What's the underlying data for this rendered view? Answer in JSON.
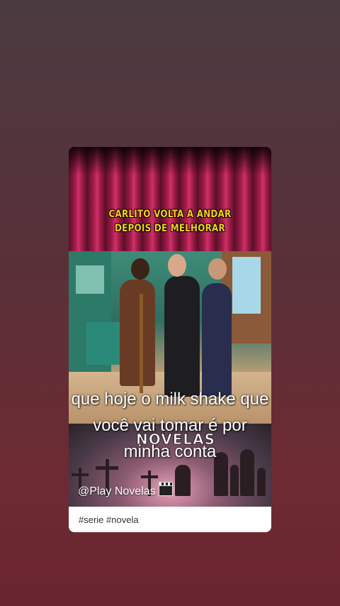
{
  "post": {
    "headline_line1": "CARLITO VOLTA A ANDAR",
    "headline_line2": "DEPOIS DE MELHORAR",
    "brand_logo": "NOVELAS",
    "account_label": "@Play Novelas",
    "hashtags": "#serie #novela"
  },
  "subtitle": {
    "line1": "que hoje o milk shake que",
    "line2": "você vai tomar é por",
    "line3": "minha conta"
  },
  "icons": {
    "clapperboard": "clapperboard-icon"
  },
  "colors": {
    "headline": "#f3d21b",
    "curtain": "#a01c48",
    "background_top": "#4a3a40",
    "background_bottom": "#6a2530"
  }
}
